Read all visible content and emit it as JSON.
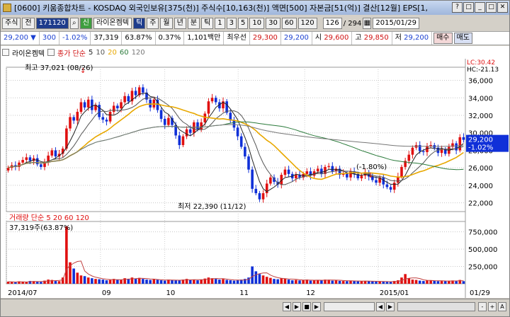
{
  "window": {
    "title": "[0600] 키움종합차트 - KOSDAQ 외국인보유[375(천)] 주식수[10,163(천)] 액면[500] 자본금[51(억)] 결산[12월] EPS[1,",
    "buttons": [
      "?",
      "□",
      "_",
      "□",
      "✕"
    ]
  },
  "toolbar": {
    "type_label": "주식",
    "prev_label": "전",
    "code": "171120",
    "signal_label": "신",
    "stock_name": "라이온켐텍",
    "periods": [
      "틱",
      "주",
      "월",
      "년",
      "분",
      "틱"
    ],
    "intervals": [
      "1",
      "3",
      "5",
      "10",
      "30",
      "60",
      "120"
    ],
    "count": "126",
    "total": "/ 294",
    "date": "2015/01/29"
  },
  "infobar": {
    "price": "29,200",
    "change": "300",
    "change_pct": "-1.02%",
    "volume": "37,319",
    "ratio": "63.87%",
    "turnover": "0.37%",
    "amount": "1,101백만",
    "best_ask_label": "최우선",
    "best_ask": "29,300",
    "best_bid": "29,200",
    "open_label": "시",
    "open": "29,600",
    "high_label": "고",
    "high": "29,850",
    "low_label": "저",
    "low": "29,200",
    "buy_label": "매수",
    "sell_label": "매도"
  },
  "chart_header": {
    "name": "라이온켐텍",
    "ma_label": "종가 단순",
    "ma_periods": [
      "5",
      "10",
      "20",
      "60",
      "120"
    ],
    "lc_label": "LC:30.42",
    "hc_label": "HC:-21.13"
  },
  "volume_header": {
    "label": "거래량 단순",
    "ma_periods": [
      "5",
      "20",
      "60",
      "120"
    ],
    "current": "37,319주(63.87%)"
  },
  "chart_data": [
    {
      "type": "candlestick",
      "ylim": [
        21000,
        37500
      ],
      "yticks": [
        22000,
        24000,
        26000,
        28000,
        30000,
        32000,
        34000,
        36000
      ],
      "ytick_labels": [
        "22,000",
        "24,000",
        "26,000",
        "28,000",
        "30,000",
        "32,000",
        "34,000",
        "36,000"
      ],
      "xtick_labels": [
        "2014/07",
        "09",
        "10",
        "11",
        "12",
        "2015/01",
        "01/29"
      ],
      "last_price_tag": "29,200",
      "last_pct_tag": "-1.02%",
      "annotations": {
        "high": "최고 37,021 (08/26)",
        "low": "최저 22,390 (11/12)",
        "pct": "(-1.80%)"
      },
      "close": [
        26000,
        26300,
        26100,
        26600,
        26900,
        27200,
        26800,
        27100,
        26400,
        26100,
        26700,
        27400,
        28000,
        27300,
        27600,
        28200,
        30500,
        31800,
        31400,
        32400,
        33500,
        32900,
        33800,
        32600,
        33200,
        31800,
        31500,
        31300,
        32400,
        33100,
        32800,
        33500,
        34200,
        33600,
        34800,
        34300,
        35200,
        34600,
        33800,
        32900,
        33800,
        32600,
        31600,
        30900,
        31700,
        30900,
        29700,
        28600,
        29600,
        30400,
        30000,
        31200,
        30400,
        31200,
        32200,
        33600,
        34000,
        33500,
        32800,
        33600,
        32300,
        31400,
        30600,
        29600,
        28400,
        27300,
        25800,
        23600,
        23100,
        22400,
        23100,
        24200,
        24900,
        24400,
        24100,
        25200,
        25800,
        25300,
        24800,
        25200,
        24900,
        25300,
        25600,
        25100,
        25600,
        25900,
        25300,
        26100,
        26200,
        25600,
        25900,
        25200,
        25400,
        24900,
        25600,
        25300,
        24800,
        25100,
        25500,
        25000,
        24600,
        24300,
        24900,
        24100,
        23800,
        23500,
        24300,
        25000,
        26100,
        26800,
        27500,
        28300,
        28600,
        27900,
        27800,
        28500,
        28600,
        28300,
        27700,
        28100,
        27600,
        28400,
        28800,
        28000,
        29500,
        29200
      ],
      "series": [
        {
          "name": "5",
          "color": "#222222"
        },
        {
          "name": "10",
          "color": "#555555"
        },
        {
          "name": "20",
          "color": "#e8a800"
        },
        {
          "name": "60",
          "color": "#2a7a3a"
        },
        {
          "name": "120",
          "color": "#777777"
        }
      ]
    },
    {
      "type": "bar",
      "title": "거래량",
      "ylim": [
        0,
        900000
      ],
      "yticks": [
        250000,
        500000,
        750000
      ],
      "ytick_labels": [
        "250,000",
        "500,000",
        "750,000"
      ],
      "values": [
        30000,
        25000,
        20000,
        35000,
        28000,
        22000,
        40000,
        38000,
        30000,
        26000,
        45000,
        60000,
        55000,
        40000,
        38000,
        90000,
        830000,
        310000,
        220000,
        160000,
        120000,
        110000,
        90000,
        80000,
        70000,
        65000,
        60000,
        50000,
        55000,
        70000,
        60000,
        55000,
        80000,
        70000,
        90000,
        75000,
        85000,
        70000,
        60000,
        55000,
        65000,
        58000,
        50000,
        45000,
        60000,
        55000,
        50000,
        48000,
        60000,
        70000,
        55000,
        60000,
        50000,
        62000,
        75000,
        90000,
        80000,
        70000,
        60000,
        68000,
        55000,
        50000,
        45000,
        50000,
        60000,
        70000,
        90000,
        250000,
        180000,
        140000,
        120000,
        100000,
        85000,
        70000,
        65000,
        80000,
        75000,
        60000,
        50000,
        55000,
        48000,
        52000,
        60000,
        45000,
        50000,
        55000,
        48000,
        60000,
        58000,
        45000,
        50000,
        42000,
        40000,
        38000,
        45000,
        40000,
        35000,
        38000,
        40000,
        36000,
        34000,
        30000,
        36000,
        30000,
        28000,
        26000,
        40000,
        50000,
        90000,
        140000,
        80000,
        60000,
        55000,
        45000,
        40000,
        50000,
        48000,
        42000,
        38000,
        40000,
        36000,
        42000,
        48000,
        36000,
        55000,
        37319
      ]
    }
  ],
  "status": {
    "buttons": [
      "◀",
      "▶",
      "■",
      "▶",
      "◀",
      "▶",
      "-",
      "+",
      "A"
    ]
  }
}
